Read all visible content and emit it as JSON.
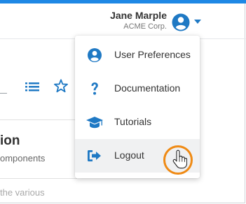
{
  "user": {
    "name": "Jane Marple",
    "company": "ACME Corp."
  },
  "background": {
    "card_title": "ion",
    "card_subtitle": "omponents",
    "card_body": "the various"
  },
  "menu": {
    "items": [
      {
        "label": "User Preferences",
        "icon": "user-circle-icon"
      },
      {
        "label": "Documentation",
        "icon": "question-mark-icon"
      },
      {
        "label": "Tutorials",
        "icon": "graduation-cap-icon"
      },
      {
        "label": "Logout",
        "icon": "sign-out-icon",
        "hovered": true
      }
    ]
  },
  "colors": {
    "accent": "#1e88e5",
    "icon_blue": "#1f79c4",
    "cursor_highlight": "#ef8a14"
  }
}
